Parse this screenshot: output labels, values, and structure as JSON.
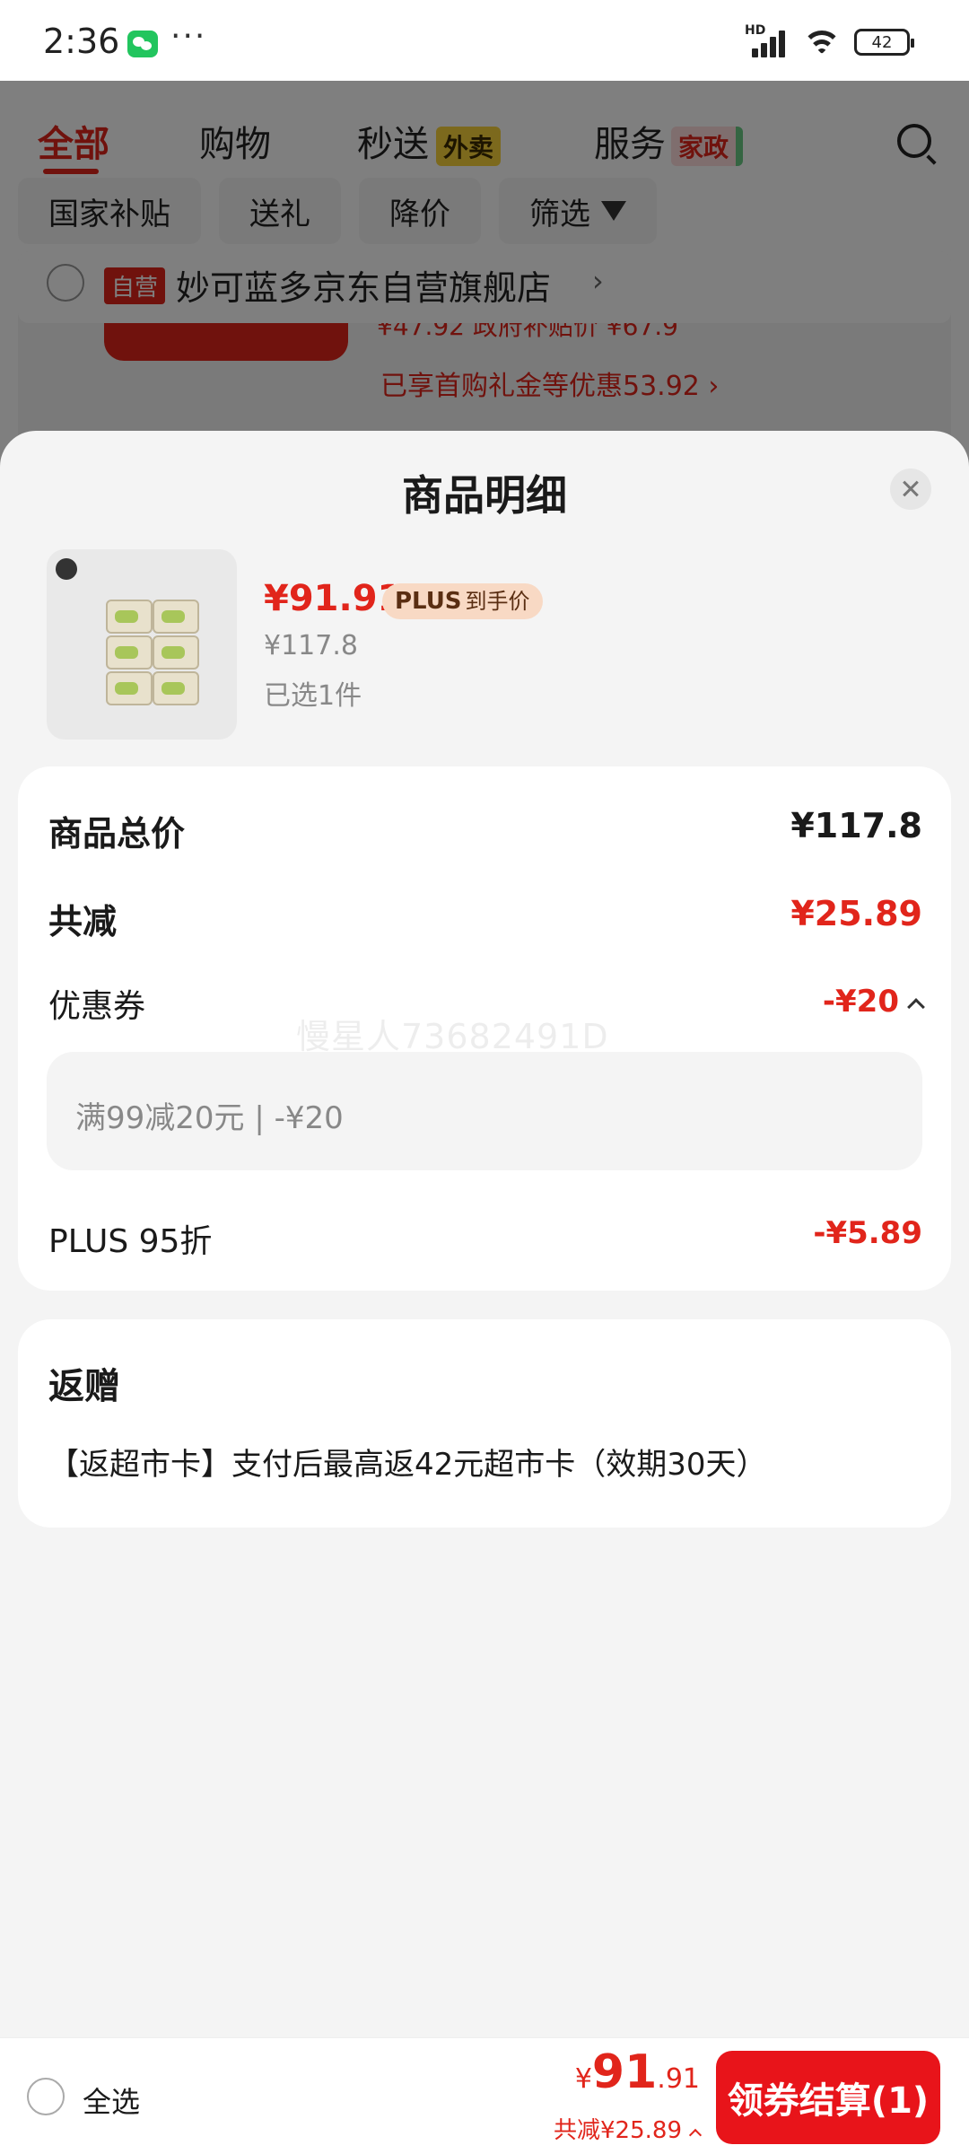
{
  "status_bar": {
    "time": "2:36",
    "more": "···",
    "network": "HD",
    "battery": "42"
  },
  "background_page": {
    "tabs": [
      {
        "label": "全部",
        "active": true
      },
      {
        "label": "购物"
      },
      {
        "label": "秒送",
        "tag": "外卖"
      },
      {
        "label": "服务",
        "tag": "家政"
      }
    ],
    "filters": [
      "国家补贴",
      "送礼",
      "降价",
      "筛选"
    ],
    "store": {
      "badge": "自营",
      "name": "妙可蓝多京东自营旗舰店",
      "arrow": "›",
      "partial_price_line": "¥47.92 政府补贴价   ¥67.9",
      "promo": "已享首购礼金等优惠53.92 ›"
    }
  },
  "sheet": {
    "title": "商品明细",
    "product": {
      "price": "¥91.91",
      "plus_badge": "PLUS",
      "plus_badge_suffix": "到手价",
      "original_price": "¥117.8",
      "selected": "已选1件"
    },
    "price_breakdown": {
      "total_label": "商品总价",
      "total_value": "¥117.8",
      "discount_label": "共减",
      "discount_value": "¥25.89",
      "coupon_label": "优惠券",
      "coupon_value": "-¥20",
      "coupon_detail": "满99减20元 | -¥20",
      "plus_label": "PLUS 95折",
      "plus_value": "-¥5.89",
      "watermark": "慢星人73682491D"
    },
    "gift": {
      "title": "返赠",
      "text": "【返超市卡】支付后最高返42元超市卡（效期30天）"
    }
  },
  "bottom_bar": {
    "select_all": "全选",
    "currency": "¥",
    "total_int": "91",
    "total_dec": ".91",
    "discount": "共减¥25.89",
    "checkout": "领券结算(1)"
  },
  "colors": {
    "accent_red": "#e1251b",
    "plus_badge_bg": "#f8d9c4",
    "sheet_bg": "#f4f4f4"
  }
}
